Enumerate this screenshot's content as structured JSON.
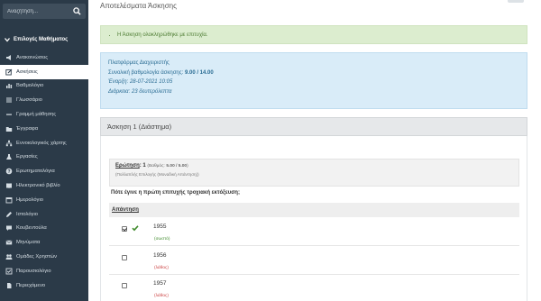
{
  "sidebar": {
    "search_placeholder": "Αναζήτηση...",
    "section_title": "Επιλογές Μαθήματος",
    "items": [
      {
        "label": "Ανακοινώσεις",
        "icon": "megaphone-icon",
        "active": false
      },
      {
        "label": "Ασκήσεις",
        "icon": "edit-icon",
        "active": true
      },
      {
        "label": "Βαθμολόγιο",
        "icon": "bar-chart-icon",
        "active": false
      },
      {
        "label": "Γλωσσάριο",
        "icon": "list-icon",
        "active": false
      },
      {
        "label": "Γραμμή μάθησης",
        "icon": "minus-icon",
        "active": false
      },
      {
        "label": "Έγγραφα",
        "icon": "folder-icon",
        "active": false
      },
      {
        "label": "Εννοιολογικός χάρτης",
        "icon": "sitemap-icon",
        "active": false
      },
      {
        "label": "Εργασίες",
        "icon": "flask-icon",
        "active": false
      },
      {
        "label": "Ερωτηματολόγια",
        "icon": "question-icon",
        "active": false
      },
      {
        "label": "Ηλεκτρονικό βιβλίο",
        "icon": "book-icon",
        "active": false
      },
      {
        "label": "Ημερολόγιο",
        "icon": "calendar-icon",
        "active": false
      },
      {
        "label": "Ιστολόγιο",
        "icon": "pencil-icon",
        "active": false
      },
      {
        "label": "Κουβεντούλα",
        "icon": "chat-icon",
        "active": false
      },
      {
        "label": "Μηνύματα",
        "icon": "envelope-icon",
        "active": false
      },
      {
        "label": "Ομάδες Χρηστών",
        "icon": "users-icon",
        "active": false
      },
      {
        "label": "Παρουσιολόγιο",
        "icon": "checklist-icon",
        "active": false
      },
      {
        "label": "Περιεχόμενο",
        "icon": "file-icon",
        "active": false
      }
    ]
  },
  "main": {
    "page_title": "Αποτελέσματα Άσκησης",
    "success_message": "Η Άσκηση ολοκληρώθηκε με επιτυχία.",
    "info": {
      "platform": "Πλατφόρμας Διαχειριστής",
      "total_grade_label": "Συνολική βαθμολογία άσκησης:",
      "total_grade_value": "9.00 / 14.00",
      "start_label": "Έναρξη:",
      "start_value": "28-07-2021 10:05",
      "duration_label": "Διάρκεια:",
      "duration_value": "23 δευτερόλεπτα"
    },
    "exercise_title": "Άσκηση 1 (Διάστημα)",
    "question": {
      "label": "Ερώτηση",
      "number": "1",
      "grade_prefix": "(Βαθμός:",
      "grade_value": "5.00 / 5.00",
      "grade_suffix": ")",
      "type": "(Πολλαπλής Επιλογής (Μοναδική Απάντηση))",
      "text": "Πότε έγινε η πρώτη επιτυχής τροχιακή εκτόξευση;",
      "answer_header": "Απάντηση",
      "answers": [
        {
          "value": "1955",
          "note": "(σωστό)",
          "checked": true,
          "correct": true
        },
        {
          "value": "1956",
          "note": "(λάθος)",
          "checked": false,
          "correct": false
        },
        {
          "value": "1957",
          "note": "(λάθος)",
          "checked": false,
          "correct": false
        }
      ]
    }
  },
  "colors": {
    "sidebar_bg": "#2b3a48",
    "success_bg": "#dcedcf",
    "info_bg": "#d9ecf8",
    "correct_green": "#3f8a2b",
    "wrong_red": "#c44"
  }
}
